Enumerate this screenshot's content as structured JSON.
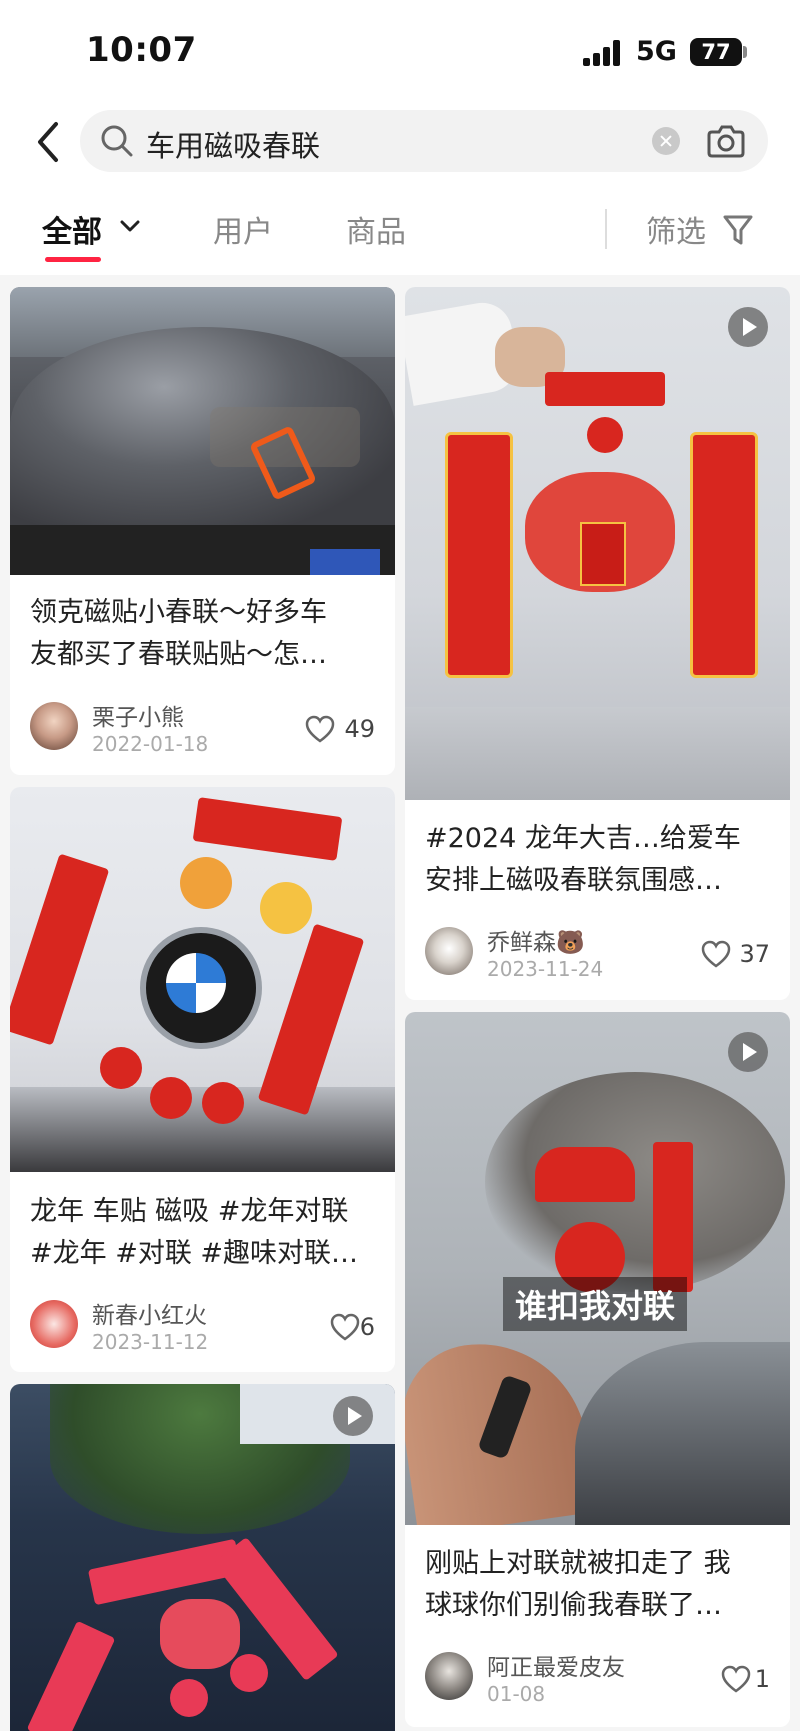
{
  "status_bar": {
    "time": "10:07",
    "network": "5G",
    "battery": "77"
  },
  "search": {
    "query": "车用磁吸春联"
  },
  "tabs": {
    "all": "全部",
    "users": "用户",
    "products": "商品",
    "filter": "筛选"
  },
  "posts": [
    {
      "title_line1": "领克磁贴小春联～好多车",
      "title_line2": "友都买了春联贴贴～怎…",
      "author": "栗子小熊",
      "date": "2022-01-18",
      "likes": "49"
    },
    {
      "title_line1": "#2024 龙年大吉…给爱车",
      "title_line2": "安排上磁吸春联氛围感…",
      "author": "乔鲜森🐻",
      "date": "2023-11-24",
      "likes": "37"
    },
    {
      "title_line1": "龙年 车贴 磁吸 #龙年对联",
      "title_line2": "#龙年 #对联 #趣味对联…",
      "author": "新春小红火",
      "date": "2023-11-12",
      "likes": "6"
    },
    {
      "title_line1": "刚贴上对联就被扣走了 我",
      "title_line2": "球球你们别偷我春联了…",
      "author": "阿正最爱皮友",
      "date": "01-08",
      "likes": "1",
      "image_caption": "谁扣我对联"
    }
  ],
  "colors": {
    "accent": "#ff2442",
    "couplet_red": "#d8261f",
    "gold": "#f5c242"
  }
}
